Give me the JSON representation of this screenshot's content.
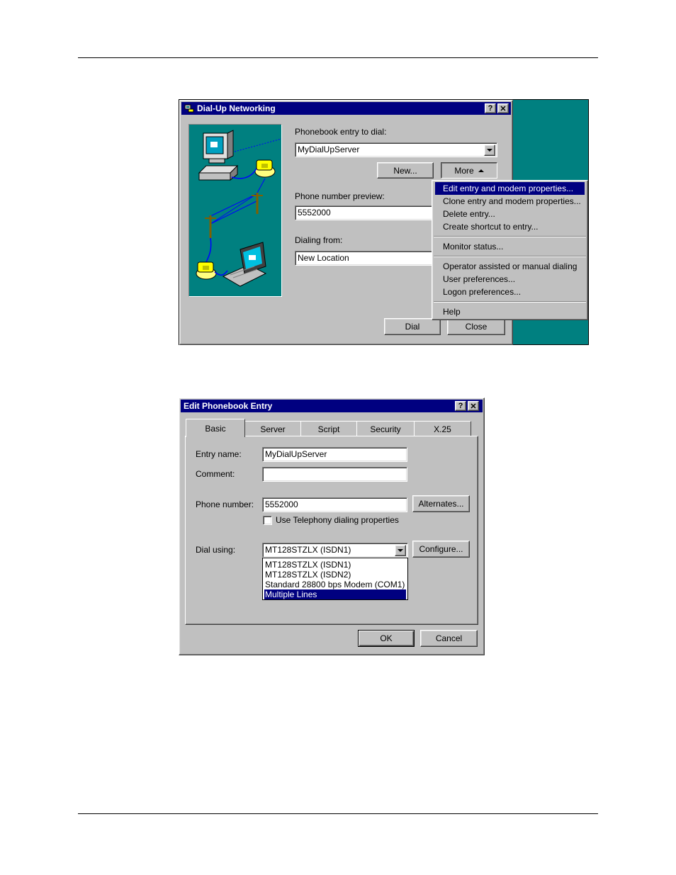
{
  "dialup": {
    "title": "Dial-Up Networking",
    "phonebook_label": "Phonebook entry to dial:",
    "phonebook_value": "MyDialUpServer",
    "new_button": "New...",
    "more_button": "More",
    "phone_preview_label": "Phone number preview:",
    "phone_preview_value": "5552000",
    "dialing_from_label": "Dialing from:",
    "dialing_from_value": "New Location",
    "dial_button": "Dial",
    "close_button": "Close",
    "help_glyph": "?",
    "close_glyph": "✕",
    "menu": [
      {
        "label": "Edit entry and modem properties...",
        "selected": true
      },
      {
        "label": "Clone entry and modem properties..."
      },
      {
        "label": "Delete entry..."
      },
      {
        "label": "Create shortcut to entry..."
      },
      {
        "label": "Monitor status..."
      },
      {
        "label": "Operator assisted or manual dialing"
      },
      {
        "label": "User preferences..."
      },
      {
        "label": "Logon preferences..."
      },
      {
        "label": "Help"
      }
    ]
  },
  "edit": {
    "title": "Edit Phonebook Entry",
    "tabs": [
      "Basic",
      "Server",
      "Script",
      "Security",
      "X.25"
    ],
    "entry_name_label": "Entry name:",
    "entry_name_value": "MyDialUpServer",
    "comment_label": "Comment:",
    "comment_value": "",
    "phone_number_label": "Phone number:",
    "phone_number_value": "5552000",
    "alternates_button": "Alternates...",
    "telephony_checkbox_label": "Use Telephony dialing properties",
    "telephony_checked": false,
    "dial_using_label": "Dial using:",
    "dial_using_value": "MT128STZLX (ISDN1)",
    "configure_button": "Configure...",
    "dial_using_options": [
      "MT128STZLX (ISDN1)",
      "MT128STZLX (ISDN2)",
      "Standard 28800 bps Modem (COM1)",
      "Multiple Lines"
    ],
    "ok_button": "OK",
    "cancel_button": "Cancel"
  },
  "colors": {
    "titlebar": "#000080",
    "desktop": "#008080",
    "face": "#c0c0c0"
  }
}
